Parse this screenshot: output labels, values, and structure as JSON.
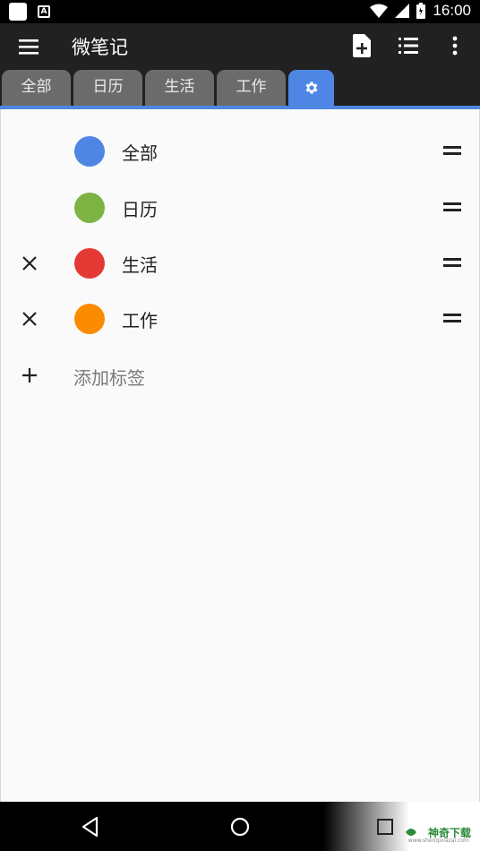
{
  "status_bar": {
    "time": "16:00",
    "a_glyph": "A"
  },
  "app_bar": {
    "title": "微笔记",
    "icons": [
      "menu-icon",
      "add-note-icon",
      "list-icon",
      "more-vertical-icon"
    ]
  },
  "tabs": [
    {
      "label": "全部"
    },
    {
      "label": "日历"
    },
    {
      "label": "生活"
    },
    {
      "label": "工作"
    },
    {
      "label": "",
      "icon": "gear-icon",
      "active": true
    }
  ],
  "tags": [
    {
      "label": "全部",
      "color": "#4f86e4",
      "removable": false
    },
    {
      "label": "日历",
      "color": "#7cb342",
      "removable": false
    },
    {
      "label": "生活",
      "color": "#e53935",
      "removable": true
    },
    {
      "label": "工作",
      "color": "#fb8c00",
      "removable": true
    }
  ],
  "add_tag": {
    "label": "添加标签"
  },
  "watermark": {
    "text": "神奇下载",
    "sub": "www.shenqixiazai.com"
  },
  "colors": {
    "accent": "#4f86e4",
    "app_bar": "#212121",
    "tab_inactive": "#6b6b6b"
  }
}
